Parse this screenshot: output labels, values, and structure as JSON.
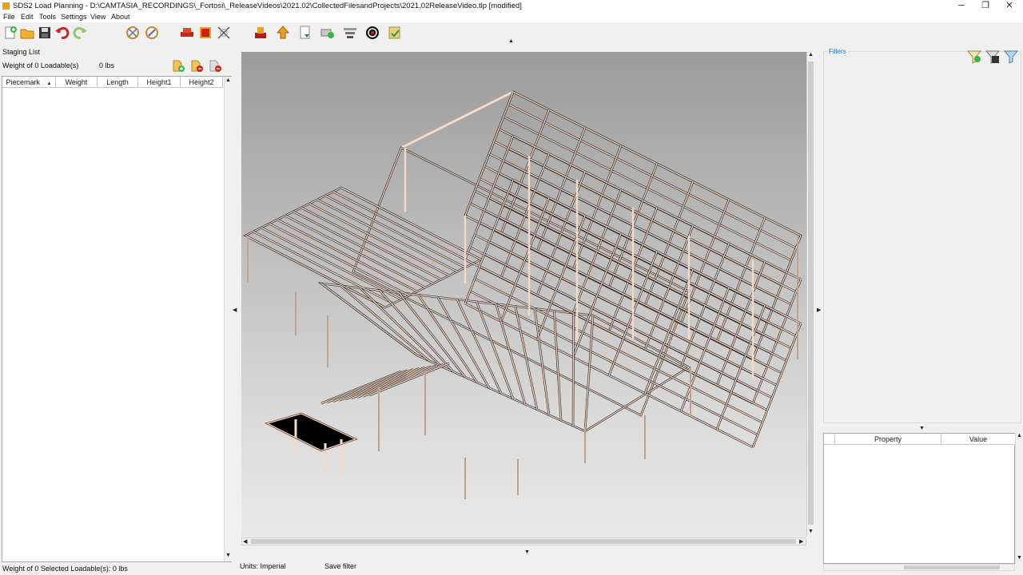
{
  "window": {
    "title": "SDS2 Load Planning - D:\\CAMTASIA_RECORDINGS\\_Fortosi\\_ReleaseVideos\\2021.02\\CollectedFilesandProjects\\2021.02ReleaseVideo.tlp [modified]",
    "minimize_glyph": "─",
    "restore_glyph": "❐",
    "close_glyph": "✕"
  },
  "menu": [
    "File",
    "Edit",
    "Tools",
    "Settings",
    "View",
    "About"
  ],
  "toolbar_icons": [
    "new-icon",
    "open-folder-icon",
    "save-icon",
    "undo-icon",
    "redo-icon",
    "rotate-view-icon",
    "orbit-icon",
    "load-truck-icon",
    "stop-icon",
    "fit-icon",
    "place-load-icon",
    "lift-icon",
    "document-icon",
    "add-truck-icon",
    "settings-icon",
    "target-icon",
    "check-icon"
  ],
  "staging": {
    "label": "Staging List",
    "weight_label": "Weight of 0 Loadable(s)",
    "weight_value": "0 lbs",
    "columns": [
      "Piecemark",
      "Weight",
      "Length",
      "Height1",
      "Height2"
    ],
    "sort_glyph": "▲",
    "add_icon": "add-loadable-icon",
    "remove_icon": "remove-loadable-icon",
    "clear_icon": "clear-list-icon"
  },
  "status": {
    "selected": "Weight of 0 Selected Loadable(s): 0 lbs",
    "units": "Units: Imperial",
    "save_filter": "Save filter"
  },
  "filters": {
    "label": "Filters",
    "icons": [
      "add-filter-icon",
      "save-filter-icon",
      "clear-filter-icon"
    ]
  },
  "properties": {
    "columns": [
      "Property",
      "Value"
    ]
  },
  "colors": {
    "steel": "#f2d9c9",
    "steel_dark": "#2a2320"
  }
}
